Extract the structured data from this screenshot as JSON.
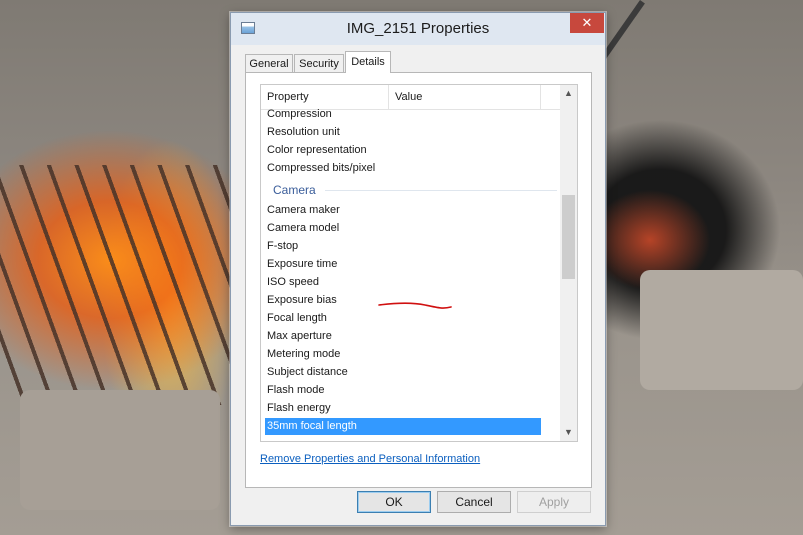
{
  "window": {
    "title": "IMG_2151 Properties",
    "close_glyph": "✕"
  },
  "tabs": [
    {
      "label": "General",
      "active": false
    },
    {
      "label": "Security",
      "active": false
    },
    {
      "label": "Details",
      "active": true
    }
  ],
  "list": {
    "columns": [
      "Property",
      "Value"
    ],
    "items_before_group": [
      "Compression",
      "Resolution unit",
      "Color representation",
      "Compressed bits/pixel"
    ],
    "group_label": "Camera",
    "items_after_group": [
      "Camera maker",
      "Camera model",
      "F-stop",
      "Exposure time",
      "ISO speed",
      "Exposure bias",
      "Focal length",
      "Max aperture",
      "Metering mode",
      "Subject distance",
      "Flash mode",
      "Flash energy",
      "35mm focal length"
    ],
    "selected_item": "35mm focal length",
    "scroll_up_glyph": "▲",
    "scroll_down_glyph": "▼"
  },
  "link_text": "Remove Properties and Personal Information",
  "buttons": {
    "ok": "OK",
    "cancel": "Cancel",
    "apply": "Apply",
    "apply_enabled": false
  },
  "colors": {
    "selection": "#3399ff",
    "annotation": "#d01010",
    "link": "#0b5fbf"
  }
}
